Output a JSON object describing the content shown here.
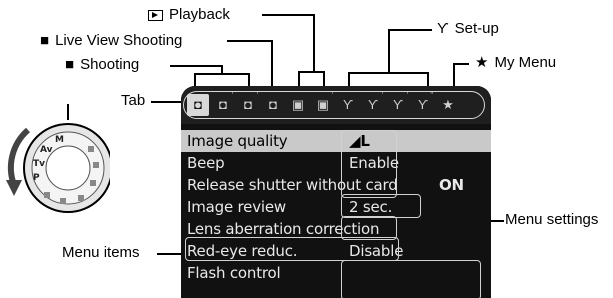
{
  "callouts": {
    "playback": "Playback",
    "live_view": "Live View Shooting",
    "shooting": "Shooting",
    "setup": "Set-up",
    "my_menu": "My Menu",
    "tab": "Tab",
    "menu_items": "Menu items",
    "menu_settings": "Menu settings"
  },
  "icons": {
    "playback": "playback-icon",
    "live_view": "camera-icon",
    "shooting": "camera-icon",
    "setup": "wrench-icon",
    "my_menu": "star-icon"
  },
  "tabs": [
    {
      "name": "shooting-1",
      "glyph": "◘",
      "sup": "",
      "active": true
    },
    {
      "name": "shooting-2",
      "glyph": "◘",
      "sup": "'"
    },
    {
      "name": "shooting-3",
      "glyph": "◘",
      "sup": "'"
    },
    {
      "name": "live-view",
      "glyph": "◘",
      "sup": ""
    },
    {
      "name": "playback-1",
      "glyph": "▣",
      "sup": ""
    },
    {
      "name": "playback-2",
      "glyph": "▣",
      "sup": "'"
    },
    {
      "name": "setup-1",
      "glyph": "ϒ",
      "sup": ""
    },
    {
      "name": "setup-2",
      "glyph": "ϒ",
      "sup": "'"
    },
    {
      "name": "setup-3",
      "glyph": "ϒ",
      "sup": "'"
    },
    {
      "name": "setup-4",
      "glyph": "ϒ",
      "sup": "''"
    },
    {
      "name": "my-menu",
      "glyph": "★",
      "sup": ""
    }
  ],
  "menu": [
    {
      "label": "Image quality",
      "value": "◢L",
      "selected": true
    },
    {
      "label": "Beep",
      "value": "Enable"
    },
    {
      "label": "Release shutter without card",
      "value": "ON"
    },
    {
      "label": "Image review",
      "value": "2 sec."
    },
    {
      "label": "Lens aberration correction",
      "value": ""
    },
    {
      "label": "Red-eye reduc.",
      "value": "Disable"
    },
    {
      "label": "Flash control",
      "value": ""
    }
  ],
  "colors": {
    "screen": "#111111",
    "highlight": "#c9c9c9"
  }
}
